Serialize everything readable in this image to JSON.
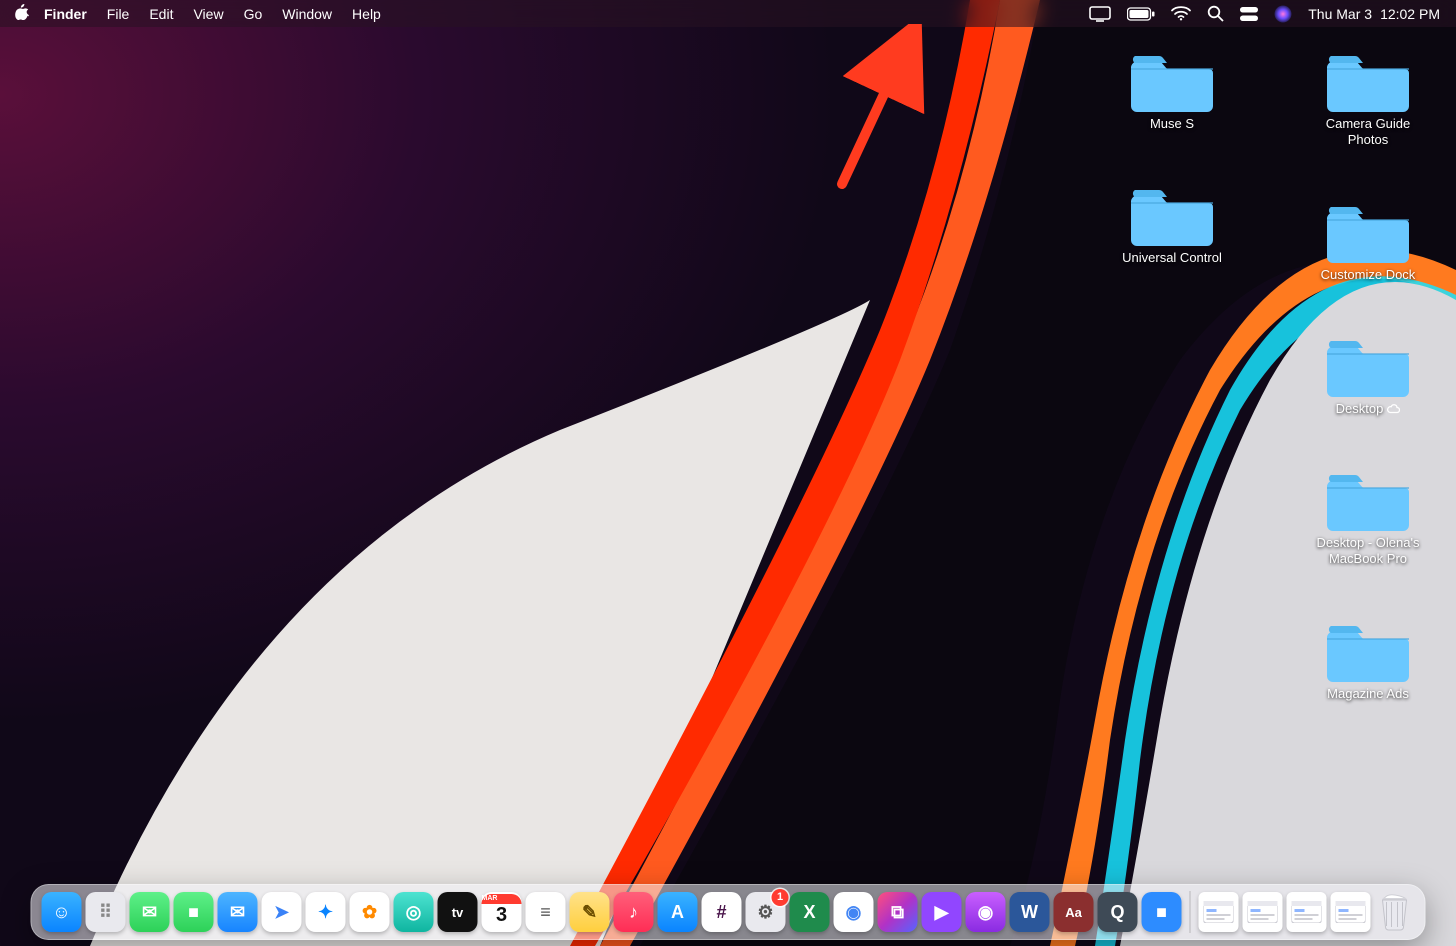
{
  "menubar": {
    "app_name": "Finder",
    "items": [
      "File",
      "Edit",
      "View",
      "Go",
      "Window",
      "Help"
    ],
    "status_icons": [
      "display-icon",
      "battery-icon",
      "wifi-icon",
      "spotlight-icon",
      "control-center-icon",
      "siri-icon"
    ],
    "date": "Thu Mar 3",
    "time": "12:02 PM"
  },
  "annotation": {
    "target": "display-icon",
    "color": "#ff3b1f"
  },
  "desktop": {
    "column_left": [
      {
        "label": "Muse S"
      },
      {
        "label": "Universal Control"
      }
    ],
    "column_right": [
      {
        "label": "Camera Guide Photos"
      },
      {
        "label": "Customize Dock"
      },
      {
        "label": "Desktop",
        "cloud": true
      },
      {
        "label": "Desktop - Olena's MacBook Pro"
      },
      {
        "label": "Magazine Ads"
      }
    ]
  },
  "dock": {
    "apps": [
      {
        "name": "finder",
        "glyph": "☺",
        "cls": "bg-finder"
      },
      {
        "name": "launchpad",
        "glyph": "⠿",
        "cls": "bg-launchpad",
        "fg": "#888"
      },
      {
        "name": "messages",
        "glyph": "✉",
        "cls": "bg-messages"
      },
      {
        "name": "facetime",
        "glyph": "■",
        "cls": "bg-facetime"
      },
      {
        "name": "mail",
        "glyph": "✉",
        "cls": "bg-mail"
      },
      {
        "name": "maps",
        "glyph": "➤",
        "cls": "bg-maps",
        "fg": "#3a82f7"
      },
      {
        "name": "safari",
        "glyph": "✦",
        "cls": "bg-safari",
        "fg": "#0a84ff"
      },
      {
        "name": "photos",
        "glyph": "✿",
        "cls": "bg-photos",
        "fg": "#ff8a00"
      },
      {
        "name": "findmy",
        "glyph": "◎",
        "cls": "bg-find"
      },
      {
        "name": "appletv",
        "glyph": "tv",
        "cls": "bg-appletv",
        "small": true
      },
      {
        "name": "calendar",
        "glyph": "3",
        "cls": "bg-calendar",
        "fg": "#111",
        "top": "MAR"
      },
      {
        "name": "reminders",
        "glyph": "≡",
        "cls": "bg-reminders",
        "fg": "#555"
      },
      {
        "name": "notes",
        "glyph": "✎",
        "cls": "bg-notes",
        "fg": "#6b4e00"
      },
      {
        "name": "music",
        "glyph": "♪",
        "cls": "bg-music"
      },
      {
        "name": "appstore",
        "glyph": "A",
        "cls": "bg-appstore"
      },
      {
        "name": "slack",
        "glyph": "#",
        "cls": "bg-slack",
        "fg": "#4a154b"
      },
      {
        "name": "settings",
        "glyph": "⚙",
        "cls": "bg-sys",
        "fg": "#555",
        "badge": "1"
      },
      {
        "name": "excel",
        "glyph": "X",
        "cls": "bg-excel"
      },
      {
        "name": "chrome",
        "glyph": "◉",
        "cls": "bg-chrome",
        "fg": "#4285f4"
      },
      {
        "name": "shortcuts",
        "glyph": "⧉",
        "cls": "bg-shortcuts"
      },
      {
        "name": "twitch",
        "glyph": "▶",
        "cls": "bg-twitch"
      },
      {
        "name": "podcasts",
        "glyph": "◉",
        "cls": "bg-podcasts"
      },
      {
        "name": "word",
        "glyph": "W",
        "cls": "bg-word"
      },
      {
        "name": "dictionary",
        "glyph": "Aa",
        "cls": "bg-dict",
        "small": true
      },
      {
        "name": "quicktime",
        "glyph": "Q",
        "cls": "bg-qt"
      },
      {
        "name": "zoom",
        "glyph": "■",
        "cls": "bg-zoom"
      }
    ],
    "minimized_count": 4,
    "trash_full": true
  }
}
